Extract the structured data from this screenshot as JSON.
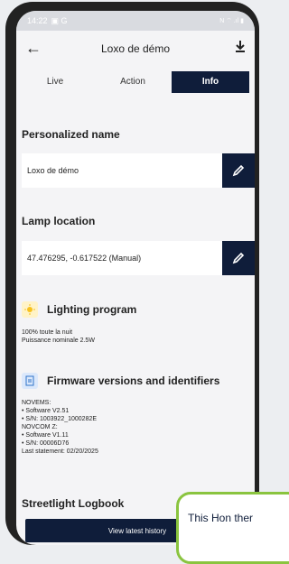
{
  "status": {
    "time": "14:22",
    "left_icons": "▣ G",
    "right_icons": "N ⌔ .ıl ▮"
  },
  "header": {
    "title": "Loxo de démo"
  },
  "tabs": [
    {
      "label": "Live"
    },
    {
      "label": "Action"
    },
    {
      "label": "Info"
    }
  ],
  "personalized_name": {
    "title": "Personalized name",
    "value": "Loxo de démo"
  },
  "lamp_location": {
    "title": "Lamp location",
    "value": "47.476295, -0.617522 (Manual)"
  },
  "lighting_program": {
    "title": "Lighting program",
    "line1": "100% toute la nuit",
    "line2": "Puissance nominale 2.5W",
    "icon_color": "#f7c21e"
  },
  "firmware": {
    "title": "Firmware versions and identifiers",
    "icon_color": "#2f73c9",
    "lines": [
      "NOVEMS:",
      "• Software V2.51",
      "• S/N: 1003922_1000282E",
      "NOVCOM Z:",
      "• Software V1.11",
      "• S/N: 00006D76",
      "Last statement: 02/20/2025"
    ]
  },
  "logbook": {
    "title": "Streetlight Logbook",
    "button_label": "View latest history"
  },
  "tooltip": {
    "text": "This Hon ther"
  },
  "colors": {
    "accent": "#0f1d3a",
    "tooltip_border": "#8ac43f"
  }
}
